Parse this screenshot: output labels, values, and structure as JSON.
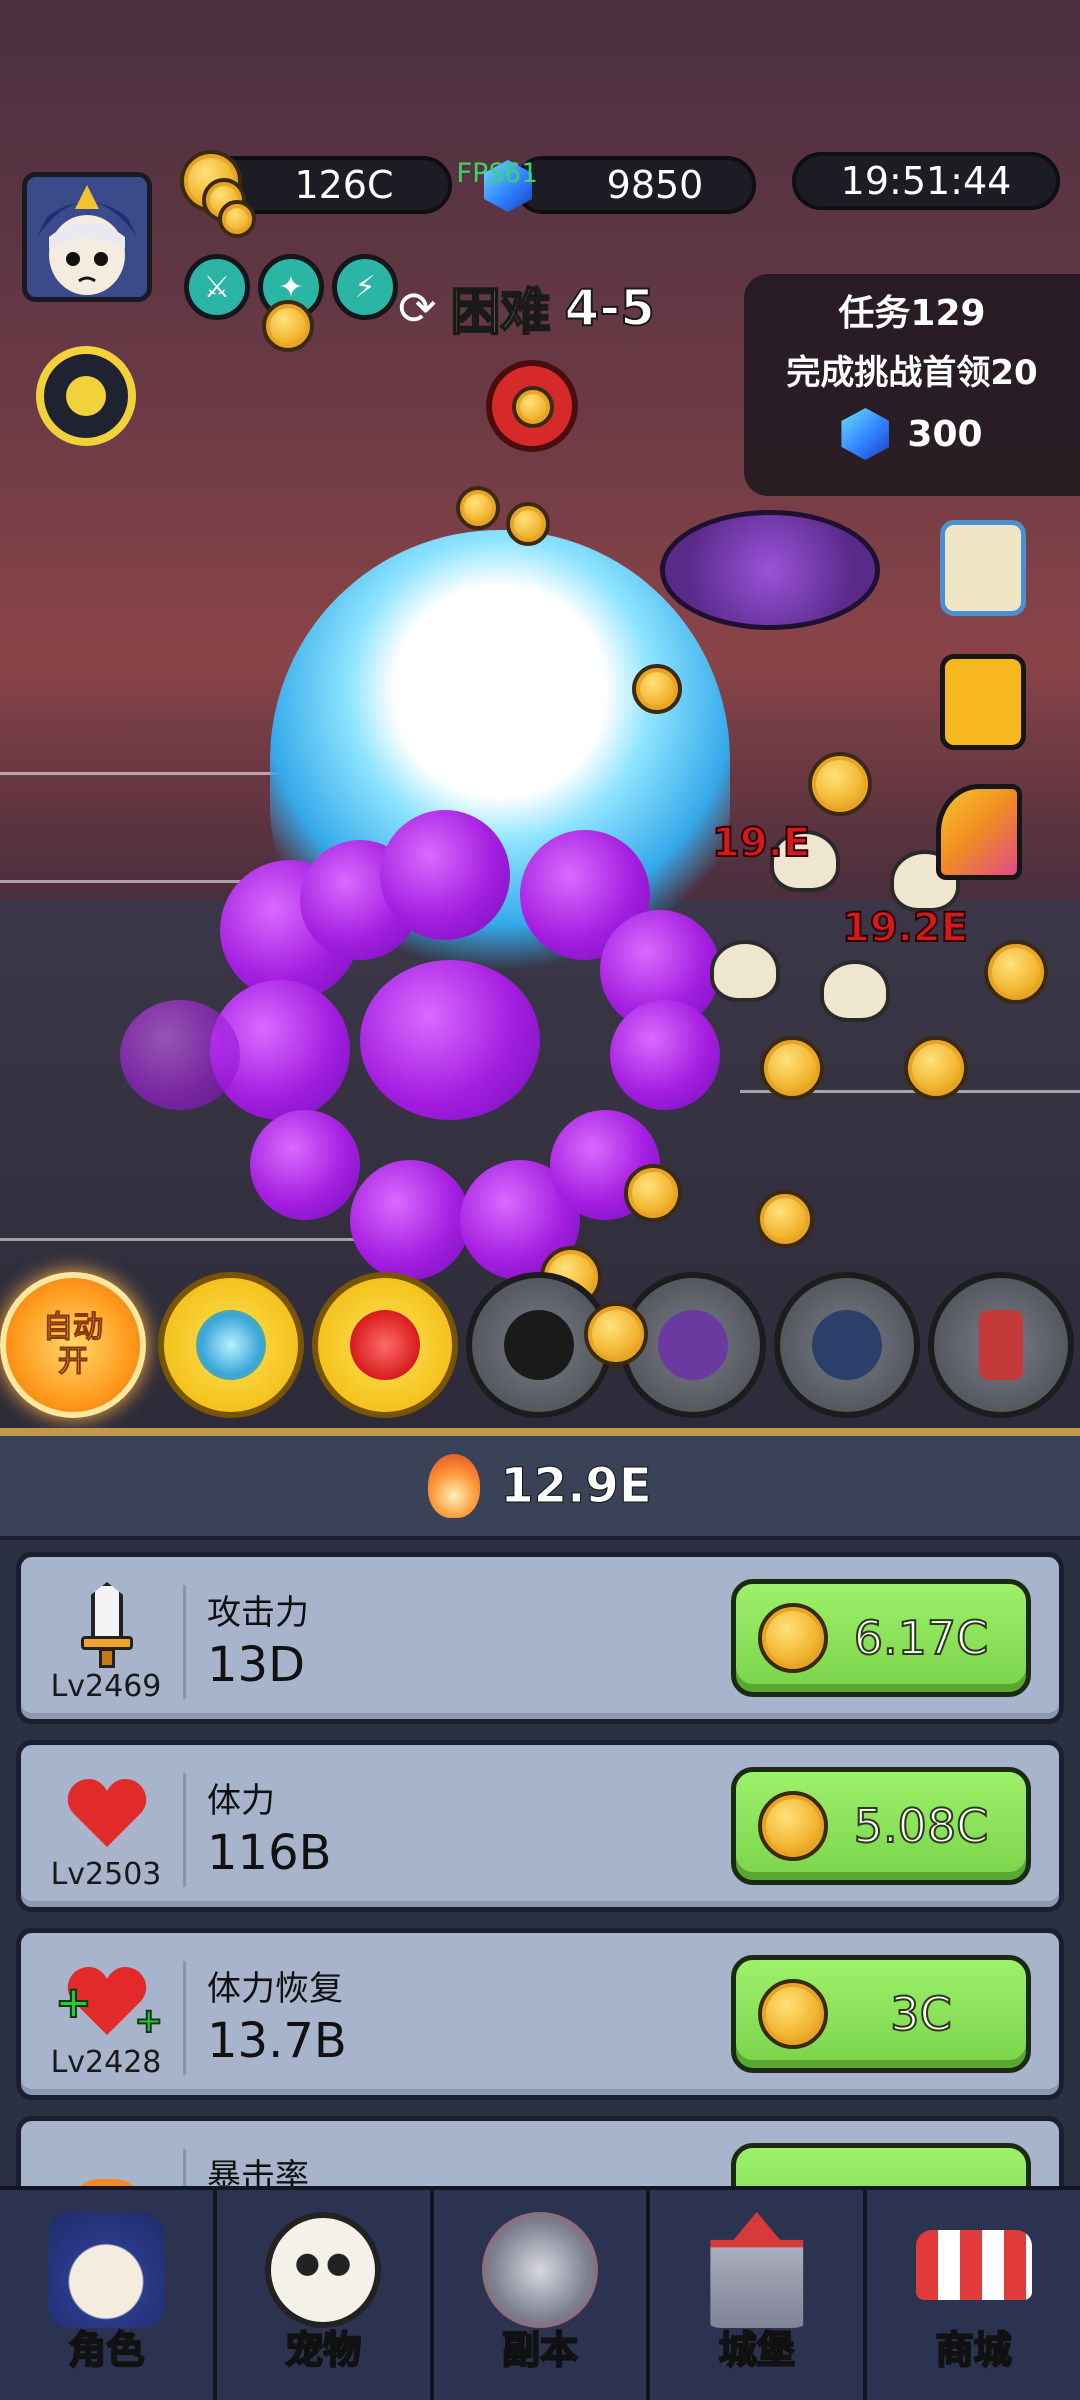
{
  "hud": {
    "gold": "126C",
    "fps": "FPS61",
    "gems": "9850",
    "clock": "19:51:44",
    "difficulty_mode": "困难",
    "stage": "4-5"
  },
  "quest": {
    "title": "任务129",
    "objective": "完成挑战首领20",
    "reward_amount": "300"
  },
  "damage_numbers": [
    "19.E",
    "19.2E"
  ],
  "skills": {
    "auto_label": "自动\n开"
  },
  "dps": {
    "value": "12.9E"
  },
  "upgrades": [
    {
      "level": "Lv2469",
      "name": "攻击力",
      "value": "13D",
      "cost": "6.17C",
      "icon": "sword-icon"
    },
    {
      "level": "Lv2503",
      "name": "体力",
      "value": "116B",
      "cost": "5.08C",
      "icon": "heart-icon"
    },
    {
      "level": "Lv2428",
      "name": "体力恢复",
      "value": "13.7B",
      "cost": "3C",
      "icon": "heart-plus-icon"
    },
    {
      "name": "暴击率",
      "icon": "crit-icon"
    }
  ],
  "nav": [
    {
      "label": "角色",
      "icon": "hero-icon"
    },
    {
      "label": "宠物",
      "icon": "panda-icon"
    },
    {
      "label": "副本",
      "icon": "crossed-swords-icon"
    },
    {
      "label": "城堡",
      "icon": "castle-icon"
    },
    {
      "label": "商城",
      "icon": "shop-icon"
    }
  ],
  "colors": {
    "accent_gold": "#f2b530",
    "buy_green": "#7ad44a",
    "panel_bg": "#2b3042",
    "card_bg": "#a7b4cc"
  }
}
